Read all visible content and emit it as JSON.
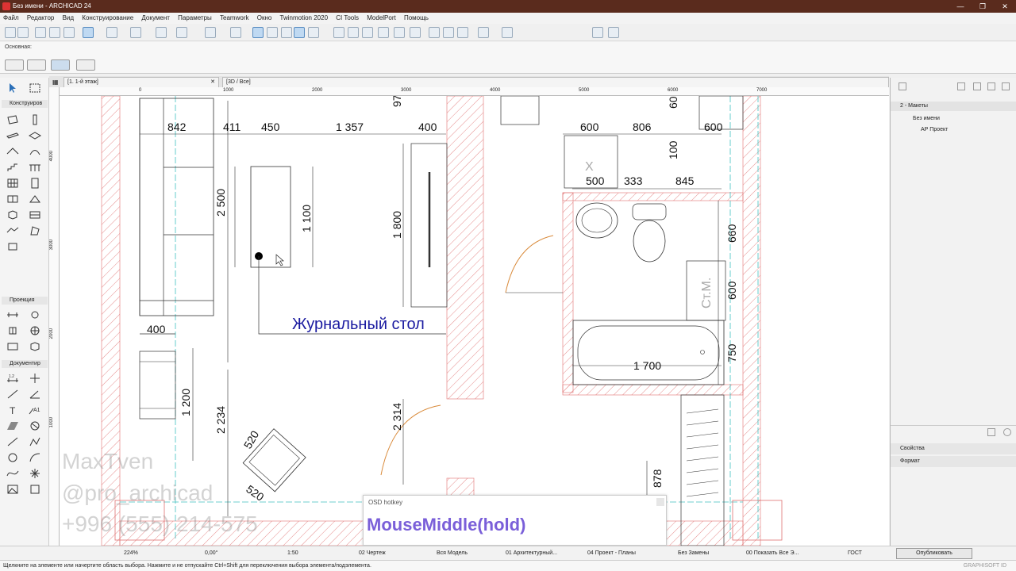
{
  "window": {
    "title": "Без имени - ARCHICAD 24",
    "minimize": "—",
    "restore": "❐",
    "close": "✕"
  },
  "menu": [
    "Файл",
    "Редактор",
    "Вид",
    "Конструирование",
    "Документ",
    "Параметры",
    "Teamwork",
    "Окно",
    "Twinmotion 2020",
    "CI Tools",
    "ModelPort",
    "Помощь"
  ],
  "infobox": {
    "label": "Основная:"
  },
  "toolbox": {
    "sections": [
      "Конструиров",
      "Проекция",
      "Документир"
    ]
  },
  "tabs": [
    {
      "label": "[1. 1-й этаж]"
    },
    {
      "label": "[3D / Все]"
    }
  ],
  "ruler_top": [
    "0",
    "1000",
    "2000",
    "3000",
    "4000",
    "5000",
    "6000",
    "7000"
  ],
  "ruler_left": [
    "4000",
    "3000",
    "2000",
    "1000"
  ],
  "drawing": {
    "dims": [
      "842",
      "411",
      "450",
      "1 357",
      "400",
      "600",
      "806",
      "600",
      "97",
      "60",
      "100",
      "500",
      "333",
      "845",
      "2 500",
      "1 100",
      "1 800",
      "660",
      "600",
      "750",
      "1 700",
      "400",
      "1 200",
      "2 234",
      "2 314",
      "520",
      "520",
      "878"
    ],
    "table_label": "Журнальный стол",
    "cabinet_label": "Ст.М.",
    "x_mark": "X"
  },
  "watermark": {
    "line1": "MaxTven",
    "line2": "@pro_archicad",
    "line3": "+996 (555) 214-575"
  },
  "osd": {
    "title": "OSD hotkey",
    "text": "MouseMiddle(hold)"
  },
  "right_panel": {
    "header": "2 - Макеты",
    "tree_root": "Без имени",
    "tree_child": "АР Проект",
    "properties": "Свойства",
    "format": "Формат"
  },
  "statusbar": {
    "zoom": "224%",
    "angle": "0,00°",
    "scale": "1:50",
    "layer_combo": "02 Чертеж",
    "model_view": "Вся Модель",
    "pen_set": "01 Архитектурный...",
    "mvo": "04 Проект - Планы",
    "renovation": "Без Замены",
    "filter": "00 Показать Все Э...",
    "dim_std": "ГОСТ",
    "publish": "Опубликовать"
  },
  "hint": "Щелкните на элементе или начертите область выбора. Нажмите и не отпускайте Ctrl+Shift для переключения выбора элемента/подэлемента.",
  "brand": "GRAPHISOFT ID",
  "colors": {
    "titlebar": "#5a2b1d",
    "dim_text": "#111111",
    "label_blue": "#1a1aa0",
    "wall_hatch": "#d9534f",
    "osd_text": "#7a5fd9",
    "door_arc": "#d98a3a"
  }
}
